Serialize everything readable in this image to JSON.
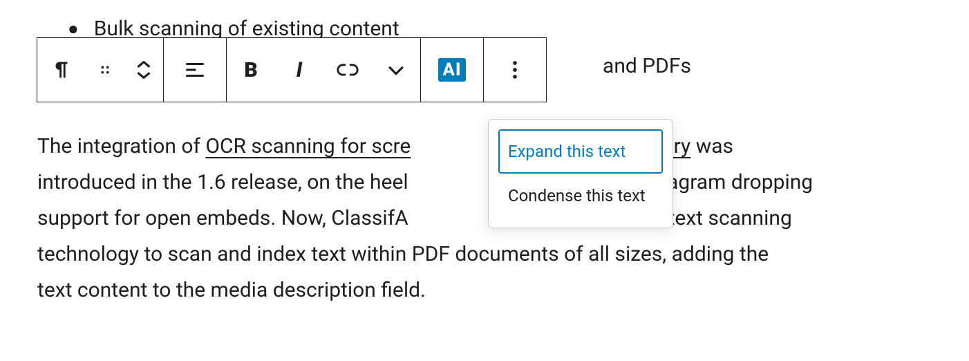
{
  "bullet": {
    "text": "Bulk scanning of existing content"
  },
  "toolbar": {
    "ai_label": "AI",
    "trailing_fragment": "and PDFs"
  },
  "ai_menu": {
    "expand": "Expand this text",
    "condense": "Condense this text"
  },
  "paragraph": {
    "lead": "The integration of ",
    "link1": "OCR scanning for scre",
    "gap1_tail_link": "r imagery",
    "tail1": " was",
    "line2a": "introduced in the 1.6 release, on the heel",
    "line2b": "d Instagram dropping",
    "line3a": "support for open embeds. Now, ClassifA",
    "line3b": "utomated text scanning",
    "line4": "technology to scan and index text within PDF documents of all sizes, adding the",
    "line5": "text content to the media description field."
  }
}
